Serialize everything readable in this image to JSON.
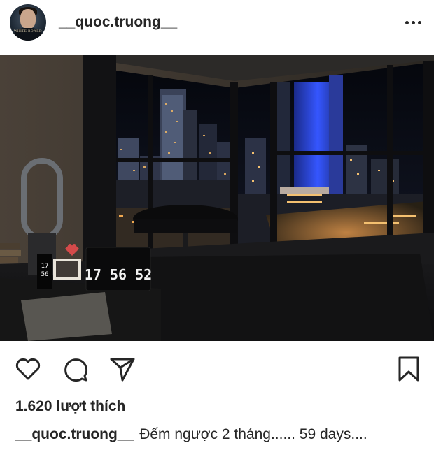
{
  "post": {
    "username": "__quoc.truong__",
    "avatar_mark": "WHITE BOARD",
    "clock_display": "17 56 52",
    "likes_text": "1.620 lượt thích",
    "caption_author": "__quoc.truong__",
    "caption_text": "Đếm ngược 2 tháng...... 59 days....",
    "clock_side_digits": "17:56"
  },
  "icons": {
    "more": "more-options-icon",
    "like": "heart-icon",
    "comment": "comment-bubble-icon",
    "share": "paper-plane-icon",
    "save": "bookmark-icon"
  },
  "colors": {
    "text": "#262626",
    "city_glow": "#f4b860",
    "tower_blue": "#2a4fff"
  }
}
